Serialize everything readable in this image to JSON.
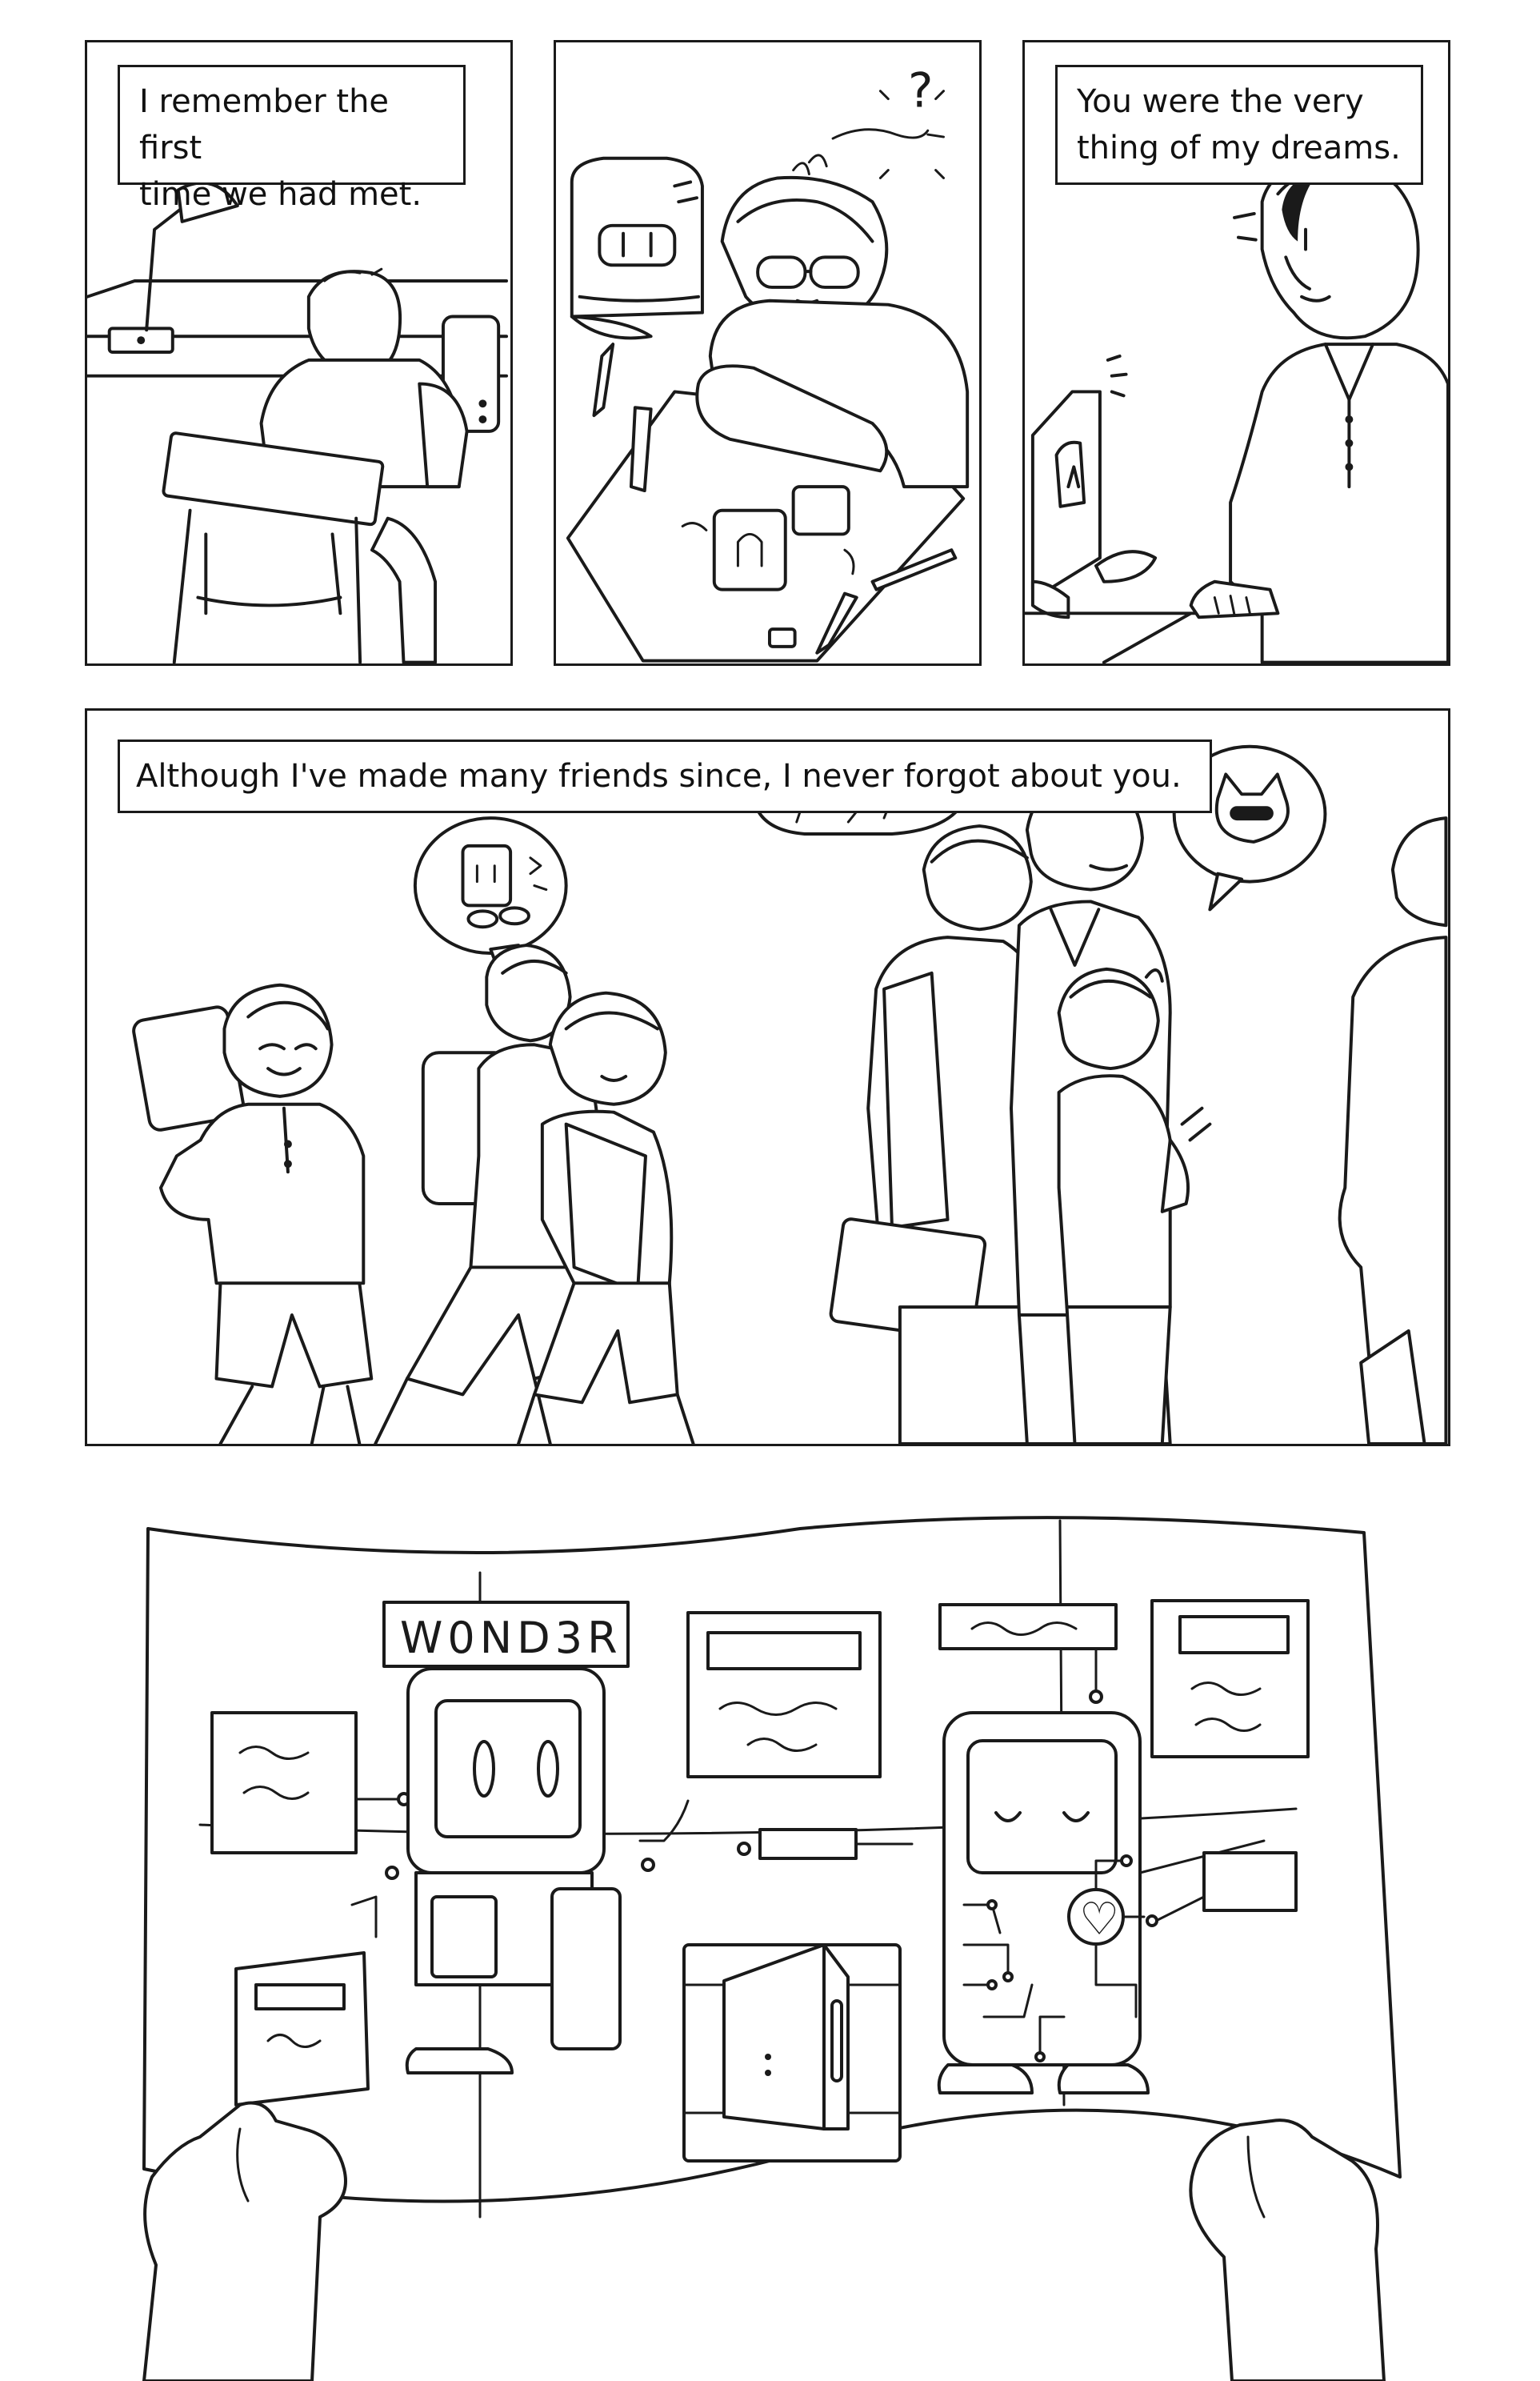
{
  "page": {
    "panel1": {
      "caption": "I remember the first\ntime we had met."
    },
    "panel2": {
      "caption": "",
      "thought_symbol": "?"
    },
    "panel3": {
      "caption": "You were the very\nthing of my dreams."
    },
    "panel4": {
      "caption": "Although I've made many friends since, I never forgot about you."
    },
    "poster": {
      "title": "W0ND3R",
      "heart_symbol": "♡"
    }
  },
  "colors": {
    "ink": "#1a1a1a",
    "paper": "#ffffff"
  },
  "icons": [
    "desk-lamp-icon",
    "robot-head-icon",
    "pencil-icon",
    "heart-icon",
    "cat-robot-icon"
  ]
}
